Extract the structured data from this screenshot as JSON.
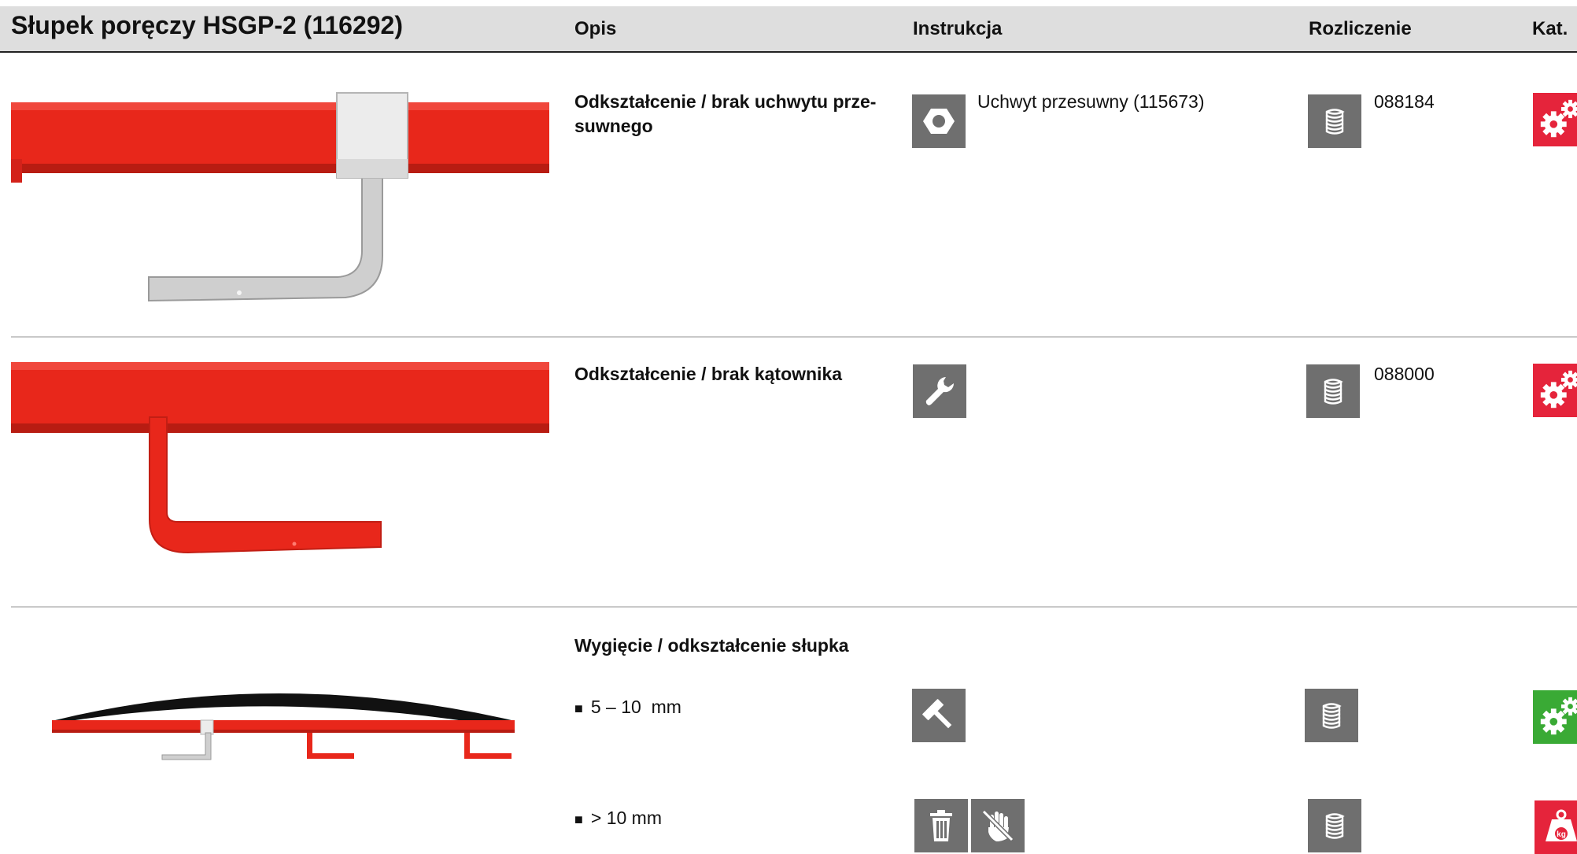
{
  "header": {
    "title": "Słupek poręczy HSGP-2 (116292)",
    "col_opis": "Opis",
    "col_instrukcja": "Instrukcja",
    "col_rozliczenie": "Rozliczenie",
    "col_kat": "Kat."
  },
  "rows": [
    {
      "description": "Odkształcenie / brak uchwytu prze-suwnego",
      "instruction_text": "Uchwyt przesuwny (115673)",
      "instruction_icon": "nut-icon",
      "billing_icon": "stack-icon",
      "billing_code": "088184",
      "category_icon": "gears-icon",
      "category_color": "#e5243b"
    },
    {
      "description": "Odkształcenie / brak kątownika",
      "instruction_icon": "wrench-icon",
      "billing_icon": "stack-icon",
      "billing_code": "088000",
      "category_icon": "gears-icon",
      "category_color": "#e5243b"
    },
    {
      "description": "Wygięcie / odkształcenie słupka",
      "subitems": [
        {
          "label": "5 – 10  mm",
          "instruction_icon": "hammer-icon",
          "billing_icon": "stack-icon",
          "category_icon": "gears-icon",
          "category_color": "#3aaa35"
        },
        {
          "label": "> 10 mm",
          "instruction_icons": [
            "trash-icon",
            "no-hand-icon"
          ],
          "billing_icon": "stack-icon",
          "category_icon": "weight-icon",
          "category_color": "#e5243b"
        }
      ]
    }
  ],
  "colors": {
    "header_bg": "#dedede",
    "icon_gray": "#6f6f6f",
    "product_red": "#e8271b",
    "category_red": "#e5243b",
    "category_green": "#3aaa35"
  }
}
